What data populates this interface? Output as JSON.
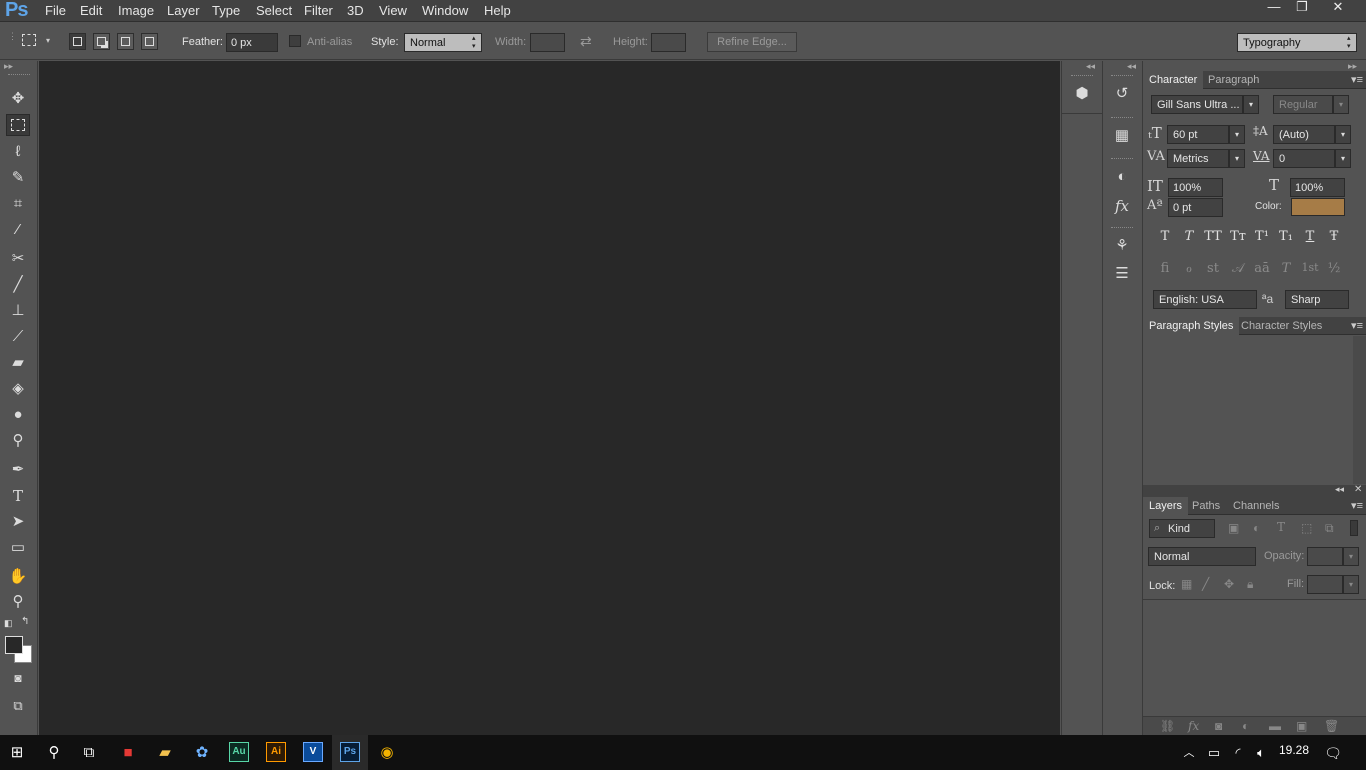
{
  "app": {
    "logo": "Ps"
  },
  "menu": [
    "File",
    "Edit",
    "Image",
    "Layer",
    "Type",
    "Select",
    "Filter",
    "3D",
    "View",
    "Window",
    "Help"
  ],
  "window_controls": {
    "minimize": "—",
    "restore": "❐",
    "close": "✕"
  },
  "options": {
    "feather_label": "Feather:",
    "feather_value": "0 px",
    "antialias_label": "Anti-alias",
    "style_label": "Style:",
    "style_value": "Normal",
    "width_label": "Width:",
    "height_label": "Height:",
    "refine_edge": "Refine Edge...",
    "workspace": "Typography"
  },
  "character_panel": {
    "tabs": [
      "Character",
      "Paragraph"
    ],
    "font_family": "Gill Sans Ultra ...",
    "font_style": "Regular",
    "font_size": "60 pt",
    "leading": "(Auto)",
    "kerning": "Metrics",
    "tracking": "0",
    "vertical_scale": "100%",
    "horizontal_scale": "100%",
    "baseline_shift": "0 pt",
    "color_label": "Color:",
    "color_swatch": "#a67c47",
    "type_buttons": [
      "T",
      "T",
      "TT",
      "Tт",
      "T¹",
      "T₁",
      "T",
      "Ŧ"
    ],
    "opentype_buttons": [
      "fi",
      "ℴ",
      "st",
      "𝒜",
      "aā",
      "T",
      "1st",
      "½"
    ],
    "language": "English: USA",
    "antialias_method": "Sharp",
    "aa_icon": "ªa"
  },
  "styles_panel": {
    "tabs": [
      "Paragraph Styles",
      "Character Styles"
    ]
  },
  "layers_panel": {
    "tabs": [
      "Layers",
      "Paths",
      "Channels"
    ],
    "filter_kind": "Kind",
    "blend_mode": "Normal",
    "opacity_label": "Opacity:",
    "lock_label": "Lock:",
    "fill_label": "Fill:"
  },
  "taskbar": {
    "apps": [
      "Au",
      "Ai",
      "V",
      "Ps"
    ],
    "clock": "19.28"
  },
  "colors": {
    "accent": "#5ea4e8",
    "canvas": "#282828",
    "panel": "#535353"
  }
}
